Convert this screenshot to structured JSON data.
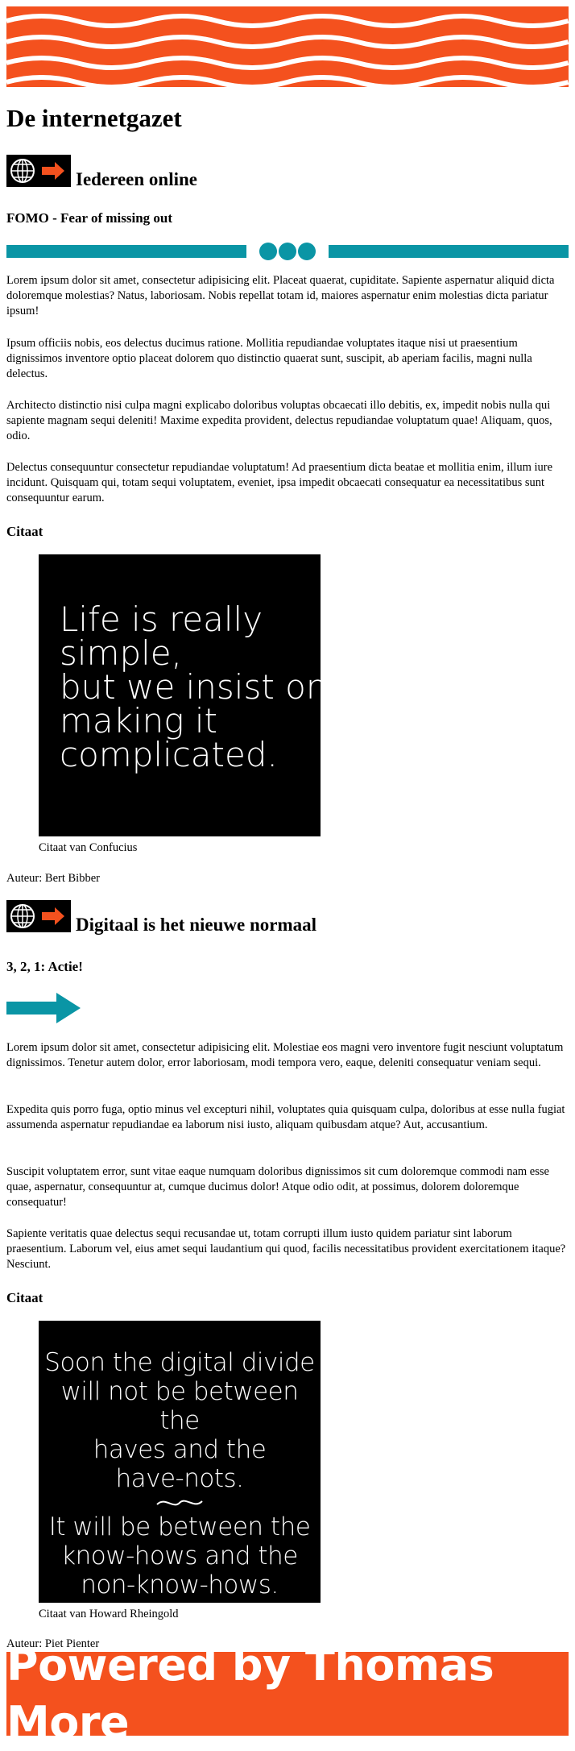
{
  "site": {
    "title": "De internetgazet"
  },
  "colors": {
    "brand_orange": "#f4511e",
    "teal": "#0a95a5",
    "black": "#000000"
  },
  "sections": [
    {
      "icon": "globe-arrow-icon",
      "heading": "Iedereen online",
      "subheading": "FOMO - Fear of missing out",
      "paragraphs": [
        "Lorem ipsum dolor sit amet, consectetur adipisicing elit. Placeat quaerat, cupiditate. Sapiente aspernatur aliquid dicta doloremque molestias? Natus, laboriosam. Nobis repellat totam id, maiores aspernatur enim molestias dicta pariatur ipsum!",
        "Ipsum officiis nobis, eos delectus ducimus ratione. Mollitia repudiandae voluptates itaque nisi ut praesentium dignissimos inventore optio placeat dolorem quo distinctio quaerat sunt, suscipit, ab aperiam facilis, magni nulla delectus.",
        "Architecto distinctio nisi culpa magni explicabo doloribus voluptas obcaecati illo debitis, ex, impedit nobis nulla qui sapiente magnam sequi deleniti! Maxime expedita provident, delectus repudiandae voluptatum quae! Aliquam, quos, odio.",
        "Delectus consequuntur consectetur repudiandae voluptatum! Ad praesentium dicta beatae et mollitia enim, illum iure incidunt. Quisquam qui, totam sequi voluptatem, eveniet, ipsa impedit obcaecati consequatur ea necessitatibus sunt consequuntur earum."
      ],
      "quote_heading": "Citaat",
      "quote_lines": [
        "Life is really",
        "simple,",
        "but we insist on",
        "making it",
        "complicated."
      ],
      "quote_caption": "Citaat van Confucius",
      "author": "Auteur: Bert Bibber"
    },
    {
      "icon": "globe-arrow-icon",
      "heading": "Digitaal is het nieuwe normaal",
      "subheading": "3, 2, 1: Actie!",
      "paragraphs": [
        "Lorem ipsum dolor sit amet, consectetur adipisicing elit. Molestiae eos magni vero inventore fugit nesciunt voluptatum dignissimos. Tenetur autem dolor, error laboriosam, modi tempora vero, eaque, deleniti consequatur veniam sequi.",
        "Expedita quis porro fuga, optio minus vel excepturi nihil, voluptates quia quisquam culpa, doloribus at esse nulla fugiat assumenda aspernatur repudiandae ea laborum nisi iusto, aliquam quibusdam atque? Aut, accusantium.",
        "Suscipit voluptatem error, sunt vitae eaque numquam doloribus dignissimos sit cum doloremque commodi nam esse quae, aspernatur, consequuntur at, cumque ducimus dolor! Atque odio odit, at possimus, dolorem doloremque consequatur!",
        "Sapiente veritatis quae delectus sequi recusandae ut, totam corrupti illum iusto quidem pariatur sint laborum praesentium. Laborum vel, eius amet sequi laudantium qui quod, facilis necessitatibus provident exercitationem itaque? Nesciunt."
      ],
      "quote_heading": "Citaat",
      "quote_lines_top": [
        "Soon the digital divide",
        "will not be between the",
        "haves and the",
        "have-nots."
      ],
      "quote_lines_bottom": [
        "It will be between the",
        "know-hows and the",
        "non-know-hows."
      ],
      "quote_caption": "Citaat van Howard Rheingold",
      "author": "Auteur: Piet Pienter"
    }
  ],
  "footer": {
    "text": "Powered by Thomas More"
  }
}
